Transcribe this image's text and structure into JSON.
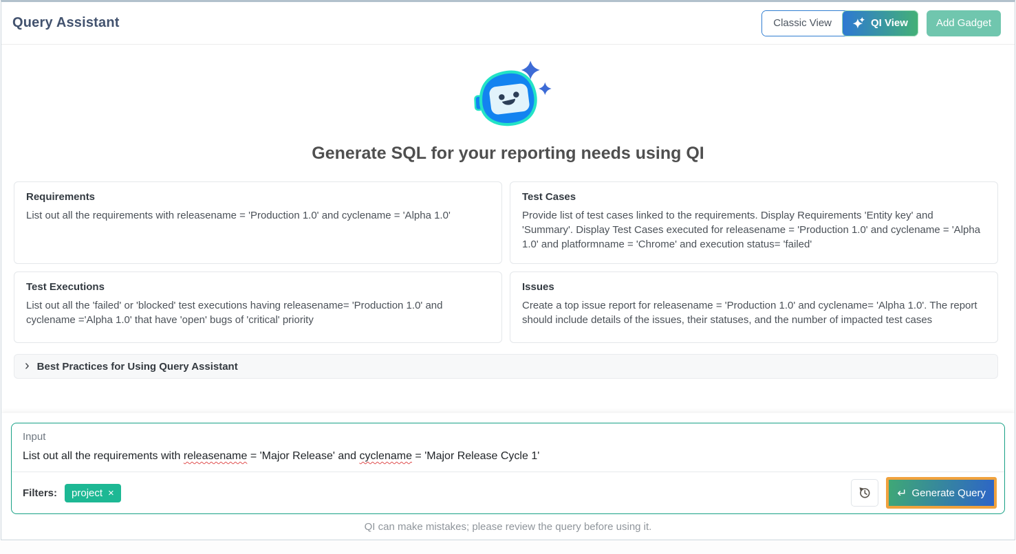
{
  "header": {
    "title": "Query Assistant",
    "classic_view_label": "Classic View",
    "qi_view_label": "QI View",
    "add_gadget_label": "Add Gadget"
  },
  "hero": {
    "heading": "Generate SQL for your reporting needs using QI"
  },
  "examples": [
    {
      "title": "Requirements",
      "text": "List out all the requirements with releasename = 'Production 1.0' and cyclename = 'Alpha 1.0'"
    },
    {
      "title": "Test Cases",
      "text": "Provide list of test cases linked to the requirements. Display Requirements 'Entity key' and 'Summary'. Display Test Cases executed for releasename = 'Production 1.0' and cyclename = 'Alpha 1.0' and platformname = 'Chrome' and execution status= 'failed'"
    },
    {
      "title": "Test Executions",
      "text": "List out all the 'failed' or 'blocked' test executions having releasename= 'Production 1.0' and cyclename ='Alpha 1.0' that have 'open' bugs of 'critical' priority"
    },
    {
      "title": "Issues",
      "text": "Create a top issue report for releasename = 'Production 1.0' and cyclename= 'Alpha 1.0'. The report should include details of the issues, their statuses, and the number of impacted test cases"
    }
  ],
  "best_practices": {
    "chevron": "›",
    "label": "Best Practices for Using Query Assistant"
  },
  "input_panel": {
    "label": "Input",
    "query_part1": "List out all the requirements with ",
    "query_word1": "releasename",
    "query_part2": " = 'Major Release' and ",
    "query_word2": "cyclename",
    "query_part3": " = 'Major Release Cycle 1'",
    "filters_label": "Filters:",
    "filter_tag": {
      "label": "project",
      "remove_icon": "×"
    },
    "generate_icon": "↵",
    "generate_label": "Generate Query"
  },
  "footer": {
    "disclaimer": "QI can make mistakes; please review the query before using it."
  },
  "colors": {
    "accent_teal": "#16a085",
    "tag_green": "#1db894",
    "highlight_orange": "#f0a23e",
    "qi_gradient_start": "#2e79d2",
    "qi_gradient_end": "#43b077",
    "generate_gradient_start": "#3fa876",
    "generate_gradient_end": "#2d64c8",
    "add_gadget_green": "#70c6ae",
    "title_color": "#42526e"
  }
}
